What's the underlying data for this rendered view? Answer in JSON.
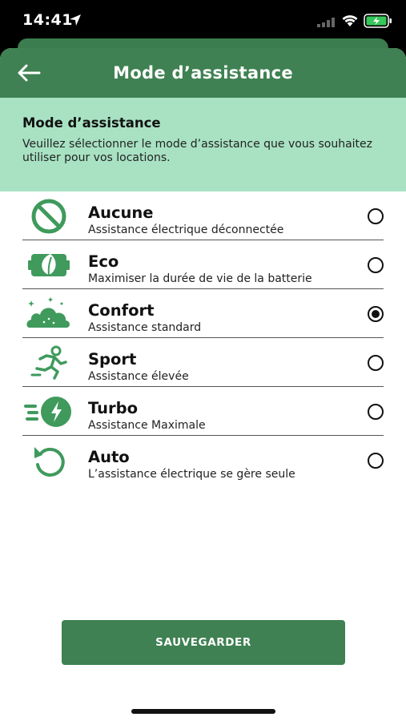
{
  "status_bar": {
    "time": "14:41"
  },
  "header": {
    "title": "Mode d’assistance"
  },
  "info": {
    "title": "Mode d’assistance",
    "text": "Veuillez sélectionner le mode d’assistance que vous souhaitez utiliser pour vos locations."
  },
  "modes": [
    {
      "name": "Aucune",
      "description": "Assistance électrique déconnectée",
      "icon": "no-entry-icon",
      "selected": false
    },
    {
      "name": "Eco",
      "description": "Maximiser la durée de vie de la batterie",
      "icon": "leaf-battery-icon",
      "selected": false
    },
    {
      "name": "Confort",
      "description": "Assistance standard",
      "icon": "cloud-icon",
      "selected": true
    },
    {
      "name": "Sport",
      "description": "Assistance élevée",
      "icon": "runner-icon",
      "selected": false
    },
    {
      "name": "Turbo",
      "description": "Assistance Maximale",
      "icon": "lightning-speed-icon",
      "selected": false
    },
    {
      "name": "Auto",
      "description": "L’assistance électrique se gère seule",
      "icon": "rotate-arrow-icon",
      "selected": false
    }
  ],
  "save_label": "SAUVEGARDER",
  "colors": {
    "primary_green": "#3f8152",
    "banner_green": "#a8e2c3",
    "icon_green": "#3f9a5c"
  }
}
